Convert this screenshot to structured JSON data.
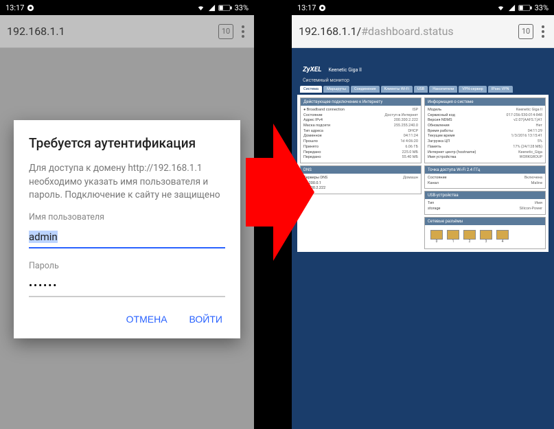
{
  "status": {
    "time": "13:17",
    "battery": "33%"
  },
  "left": {
    "address": "192.168.1.1",
    "tab_count": "10",
    "dialog": {
      "title": "Требуется аутентификация",
      "message": "Для доступа к домену http://192.168.1.1 необходимо указать имя пользователя и пароль. Подключение к сайту не защищено",
      "username_label": "Имя пользователя",
      "username_value": "admin",
      "password_label": "Пароль",
      "password_value": "••••••",
      "cancel": "ОТМЕНА",
      "login": "ВОЙТИ"
    }
  },
  "right": {
    "address_dark": "192.168.1.1/",
    "address_faded": "#dashboard.status",
    "tab_count": "10",
    "router": {
      "brand": "ZyXEL",
      "model": "Keenetic Giga II",
      "subtitle": "Системный монитор",
      "tabs": [
        "Система",
        "Маршруты",
        "Соединения",
        "Клиенты Wi-Fi",
        "USB",
        "Накопители",
        "VPN-сервер",
        "IPsec VPN"
      ],
      "left_panels": [
        {
          "title": "Действующее подключение к Интернету",
          "rows": [
            [
              "● Broadband connection",
              "ISP",
              ""
            ],
            [
              "Состояние",
              "Доступ в Интернет",
              ""
            ],
            [
              "Адрес IPv4",
              "200.200.2.222",
              "↻"
            ],
            [
              "Маска подсети",
              "255.255.240.0",
              ""
            ],
            [
              "Тип адреса",
              "DHCP",
              ""
            ],
            [
              "Доменное",
              "04:11:24",
              ""
            ],
            [
              "Прошло",
              "1d 4:06:20",
              ""
            ],
            [
              "Принято",
              "6.06 ГБ",
              ""
            ],
            [
              "Передано",
              "225.0 МБ",
              ""
            ],
            [
              "Передано",
              "55.40 МБ",
              ""
            ]
          ]
        },
        {
          "title": "DNS",
          "rows": [
            [
              "Серверы DNS",
              "Домашн"
            ],
            [
              "81.200.0.1",
              ""
            ],
            [
              "81.200.2.222",
              ""
            ]
          ]
        }
      ],
      "right_panels": [
        {
          "title": "Информация о системе",
          "rows": [
            [
              "Модель",
              "Keenetic Giga II"
            ],
            [
              "Сервисный код",
              "017-256-530-014-848"
            ],
            [
              "Версия NDMS",
              "v2.07(AAFS.1)A1"
            ],
            [
              "Обновления",
              "Нет"
            ],
            [
              "Время работы",
              "04:11:29"
            ],
            [
              "Текущее время",
              "1/3/2016 13:15:41"
            ],
            [
              "Загрузка ЦП",
              "5%"
            ],
            [
              "Память",
              "17% (24/128 МБ)"
            ],
            [
              "Интернет центр (hostname)",
              "Keenetic_Giga"
            ],
            [
              "Имя устройства",
              "WORKGROUP"
            ]
          ]
        },
        {
          "title": "Точка доступа Wi-Fi 2.4 ГГц",
          "rows": [
            [
              "Состояние",
              "Включена"
            ],
            [
              "Канал",
              "Maline"
            ]
          ]
        },
        {
          "title": "USB-устройства",
          "rows": [
            [
              "Тип",
              "Имя"
            ],
            [
              "storage",
              "Silicon-Power"
            ]
          ]
        },
        {
          "title": "Сетевые разъёмы",
          "ports": [
            "0",
            "1",
            "2",
            "3",
            "4"
          ]
        }
      ]
    }
  }
}
